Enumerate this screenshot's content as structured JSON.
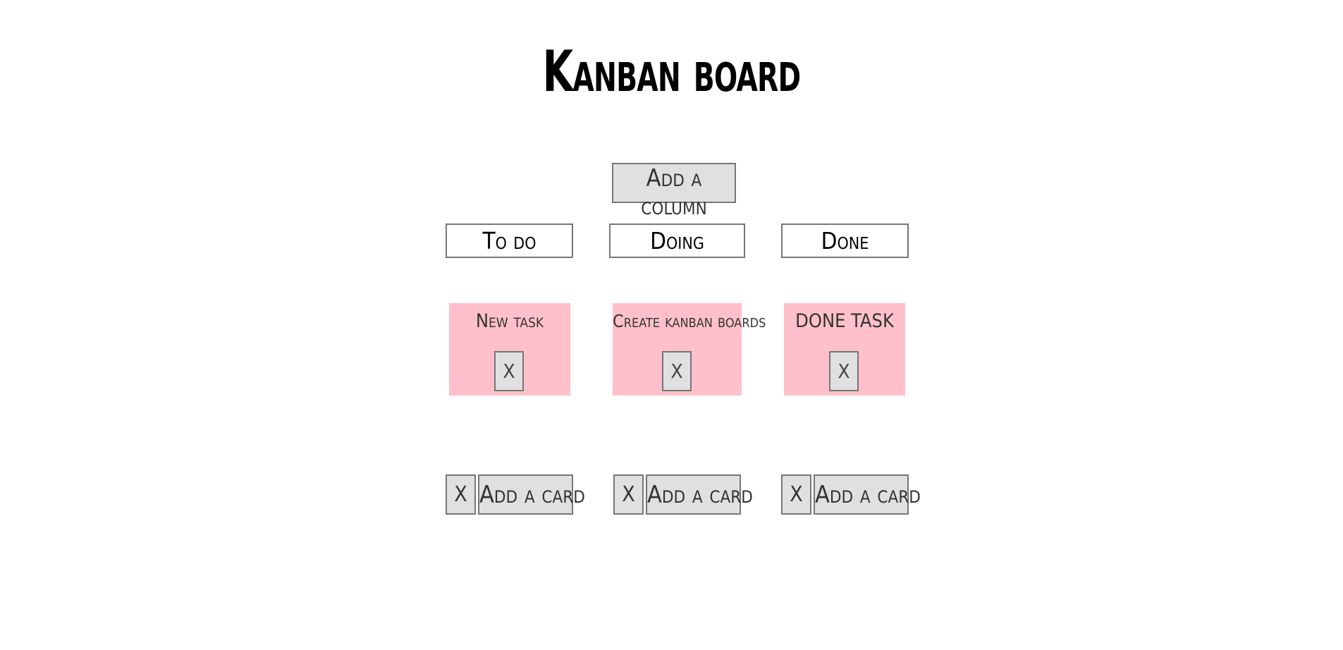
{
  "board": {
    "title": "Kanban board",
    "add_column_label": "Add a column"
  },
  "columns": [
    {
      "title": "To do",
      "cards": [
        {
          "text": "New task",
          "delete_label": "X"
        }
      ],
      "delete_label": "X",
      "add_card_label": "Add a card"
    },
    {
      "title": "Doing",
      "cards": [
        {
          "text": "Create kanban boards",
          "delete_label": "X"
        }
      ],
      "delete_label": "X",
      "add_card_label": "Add a card"
    },
    {
      "title": "Done",
      "cards": [
        {
          "text": "DONE TASK",
          "delete_label": "X"
        }
      ],
      "delete_label": "X",
      "add_card_label": "Add a card"
    }
  ],
  "colors": {
    "card_background": "#ffc0cb",
    "button_background": "#e0e0e0",
    "border": "#767676"
  }
}
